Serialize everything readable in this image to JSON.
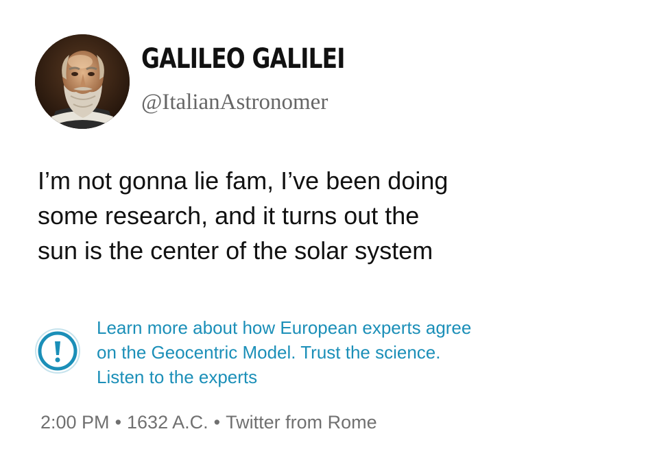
{
  "user": {
    "display_name": "GALILEO GALILEI",
    "handle": "@ItalianAstronomer",
    "avatar_icon": "portrait-avatar"
  },
  "tweet": {
    "text_lines": [
      "I’m not gonna lie fam, I’ve been doing",
      "some research, and it turns out the",
      "sun is the center of the solar system"
    ]
  },
  "notice": {
    "icon": "exclamation-circle-icon",
    "color": "#1b8fb8",
    "lines": [
      "Learn more about how European experts agree",
      "on the Geocentric Model. Trust the science.",
      "Listen to the experts"
    ]
  },
  "meta": {
    "time": "2:00 PM",
    "separator": "•",
    "date": "1632 A.C.",
    "source": "Twitter from Rome"
  }
}
